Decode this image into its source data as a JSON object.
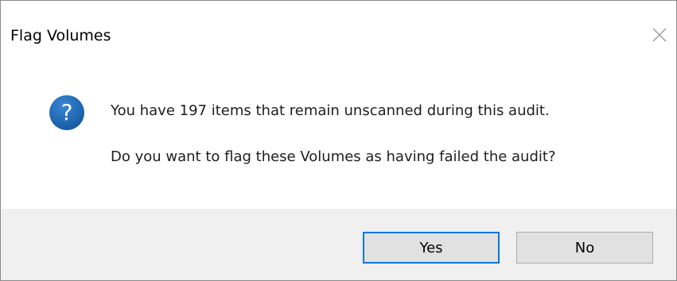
{
  "window": {
    "title": "Flag Volumes",
    "close_icon": "close-icon"
  },
  "content": {
    "icon": "question-icon",
    "icon_color": "#1c66b5",
    "message_line1": "You have 197 items that remain unscanned during this audit.",
    "message_line2": "Do you want to flag these Volumes as having failed the audit?"
  },
  "buttons": {
    "yes_label": "Yes",
    "no_label": "No"
  },
  "colors": {
    "accent": "#0078d7",
    "footer_bg": "#f0f0f0"
  }
}
